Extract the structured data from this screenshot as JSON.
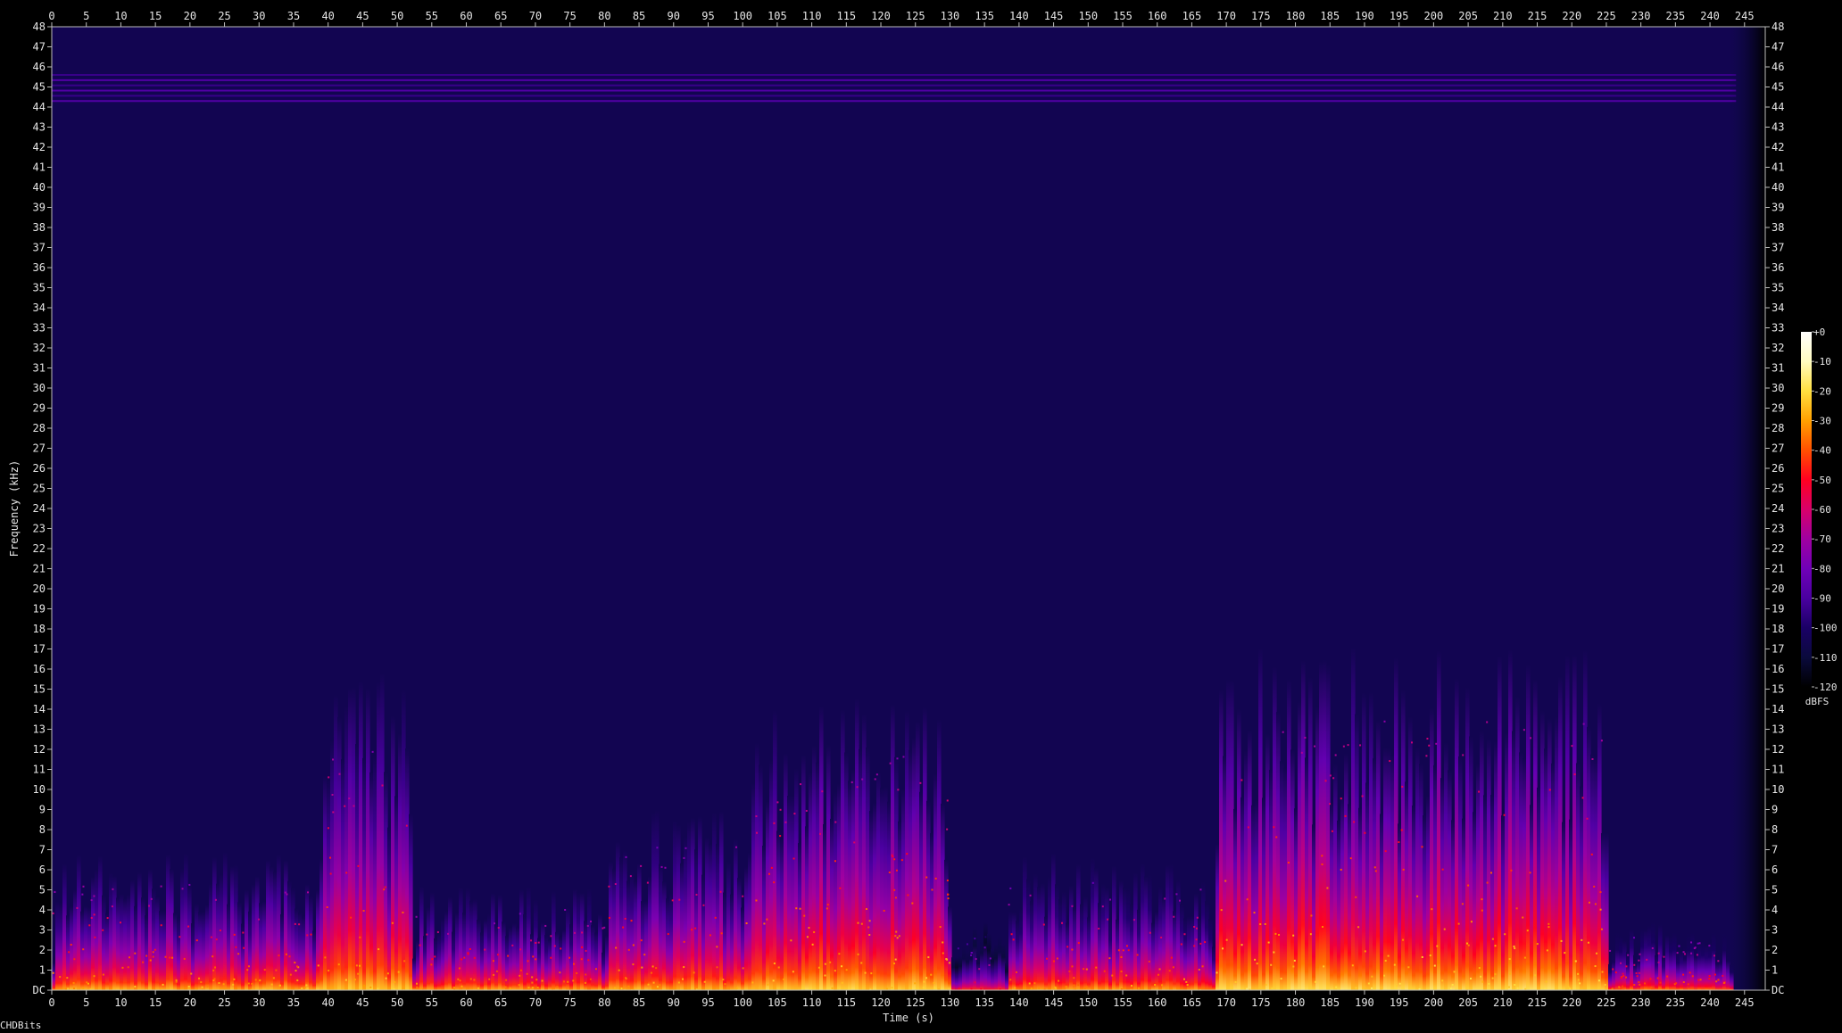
{
  "chart_data": {
    "type": "heatmap",
    "title": "",
    "xlabel": "Time (s)",
    "ylabel": "Frequency (kHz)",
    "x_range": [
      0,
      248
    ],
    "y_range": [
      0,
      48
    ],
    "x_ticks": [
      0,
      5,
      10,
      15,
      20,
      25,
      30,
      35,
      40,
      45,
      50,
      55,
      60,
      65,
      70,
      75,
      80,
      85,
      90,
      95,
      100,
      105,
      110,
      115,
      120,
      125,
      130,
      135,
      140,
      145,
      150,
      155,
      160,
      165,
      170,
      175,
      180,
      185,
      190,
      195,
      200,
      205,
      210,
      215,
      220,
      225,
      230,
      235,
      240,
      245
    ],
    "y_ticks": [
      0,
      1,
      2,
      3,
      4,
      5,
      6,
      7,
      8,
      9,
      10,
      11,
      12,
      13,
      14,
      15,
      16,
      17,
      18,
      19,
      20,
      21,
      22,
      23,
      24,
      25,
      26,
      27,
      28,
      29,
      30,
      31,
      32,
      33,
      34,
      35,
      36,
      37,
      38,
      39,
      40,
      41,
      42,
      43,
      44,
      45,
      46,
      47,
      48
    ],
    "y_zero_label": "DC",
    "signal_end_s": 243,
    "grid": false,
    "colorbar": {
      "unit": "dBFS",
      "range": [
        -120,
        0
      ],
      "ticks": [
        0,
        -10,
        -20,
        -30,
        -40,
        -50,
        -60,
        -70,
        -80,
        -90,
        -100,
        -110,
        -120
      ],
      "tick_labels": [
        "+0",
        "-10",
        "-20",
        "-30",
        "-40",
        "-50",
        "-60",
        "-70",
        "-80",
        "-90",
        "-100",
        "-110",
        "-120"
      ],
      "stops": [
        {
          "db": 0,
          "color": "#ffffff"
        },
        {
          "db": -10,
          "color": "#fffcc0"
        },
        {
          "db": -20,
          "color": "#ffe040"
        },
        {
          "db": -30,
          "color": "#ffa000"
        },
        {
          "db": -40,
          "color": "#ff5000"
        },
        {
          "db": -50,
          "color": "#ff0020"
        },
        {
          "db": -60,
          "color": "#d8006a"
        },
        {
          "db": -70,
          "color": "#a000a0"
        },
        {
          "db": -80,
          "color": "#7000b8"
        },
        {
          "db": -90,
          "color": "#4a00a0"
        },
        {
          "db": -100,
          "color": "#1a0066"
        },
        {
          "db": -110,
          "color": "#0a0a3c"
        },
        {
          "db": -120,
          "color": "#000000"
        }
      ]
    },
    "background_floor_db": -105,
    "tone_band": {
      "low_khz": 44.3,
      "high_khz": 45.6,
      "level_db": -88
    },
    "energy_regions": [
      {
        "t_start": 0,
        "t_end": 38,
        "top_khz": 6,
        "peak_db": -22
      },
      {
        "t_start": 38,
        "t_end": 52,
        "top_khz": 14,
        "peak_db": -20
      },
      {
        "t_start": 52,
        "t_end": 80,
        "top_khz": 4.5,
        "peak_db": -24
      },
      {
        "t_start": 80,
        "t_end": 100,
        "top_khz": 8,
        "peak_db": -22
      },
      {
        "t_start": 100,
        "t_end": 130,
        "top_khz": 13,
        "peak_db": -18
      },
      {
        "t_start": 130,
        "t_end": 138,
        "top_khz": 3,
        "peak_db": -40
      },
      {
        "t_start": 138,
        "t_end": 168,
        "top_khz": 6,
        "peak_db": -25
      },
      {
        "t_start": 168,
        "t_end": 225,
        "top_khz": 15,
        "peak_db": -16
      },
      {
        "t_start": 225,
        "t_end": 243,
        "top_khz": 3,
        "peak_db": -30
      }
    ],
    "colors": {
      "background": "#000000",
      "axis": "#bdbdbd",
      "text": "#e6e6e6"
    }
  },
  "footer": {
    "label": "CHDBits"
  }
}
